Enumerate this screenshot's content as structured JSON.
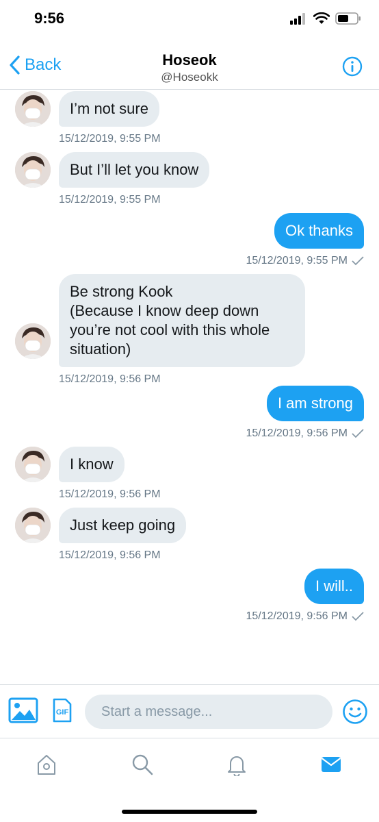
{
  "status_bar": {
    "time": "9:56"
  },
  "header": {
    "back_label": "Back",
    "title": "Hoseok",
    "handle": "@Hoseokk"
  },
  "messages": [
    {
      "direction": "in",
      "text": "I’m not sure",
      "timestamp": "15/12/2019, 9:55 PM"
    },
    {
      "direction": "in",
      "text": "But I’ll let you know",
      "timestamp": "15/12/2019, 9:55 PM"
    },
    {
      "direction": "out",
      "text": "Ok thanks",
      "timestamp": "15/12/2019, 9:55 PM",
      "read": true
    },
    {
      "direction": "in",
      "lines": [
        "Be strong Kook",
        "(Because I know deep down",
        "you’re not cool with this whole",
        "situation)"
      ],
      "timestamp": "15/12/2019, 9:56 PM"
    },
    {
      "direction": "out",
      "text": "I am strong",
      "timestamp": "15/12/2019, 9:56 PM",
      "read": true
    },
    {
      "direction": "in",
      "text": "I know",
      "timestamp": "15/12/2019, 9:56 PM"
    },
    {
      "direction": "in",
      "text": "Just keep going",
      "timestamp": "15/12/2019, 9:56 PM"
    },
    {
      "direction": "out",
      "text": "I will..",
      "timestamp": "15/12/2019, 9:56 PM",
      "read": true
    }
  ],
  "composer": {
    "placeholder": "Start a message...",
    "gif_label": "GIF"
  },
  "tabs": [
    {
      "icon": "home-icon"
    },
    {
      "icon": "search-icon"
    },
    {
      "icon": "notifications-icon"
    },
    {
      "icon": "messages-icon",
      "active": true
    }
  ],
  "colors": {
    "accent": "#1da1f2",
    "incoming_bubble": "#e6ecf0",
    "timestamp": "#657786"
  }
}
